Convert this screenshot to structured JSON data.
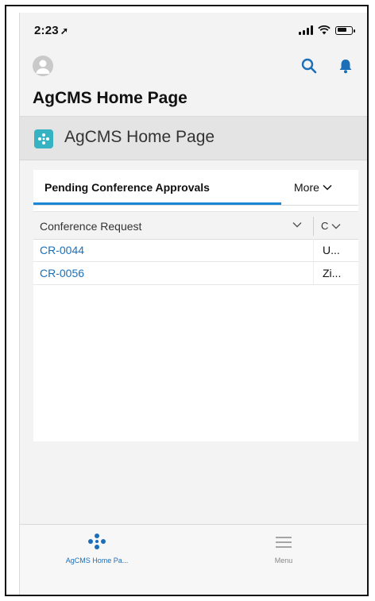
{
  "status_bar": {
    "time": "2:23",
    "location_glyph": "➚"
  },
  "header": {
    "title": "AgCMS Home Page"
  },
  "app_banner": {
    "title": "AgCMS Home Page",
    "accent": "#36b3c2"
  },
  "tabs": {
    "active": "Pending Conference Approvals",
    "more": "More"
  },
  "table": {
    "columns": [
      "Conference Request",
      "C"
    ],
    "rows": [
      {
        "request": "CR-0044",
        "c": "U..."
      },
      {
        "request": "CR-0056",
        "c": "Zi..."
      }
    ]
  },
  "bottom_nav": {
    "home": "AgCMS Home Pa...",
    "menu": "Menu"
  },
  "colors": {
    "link": "#1b6fb8",
    "active_tab": "#1b86d6",
    "icons": "#1b6fb8"
  }
}
